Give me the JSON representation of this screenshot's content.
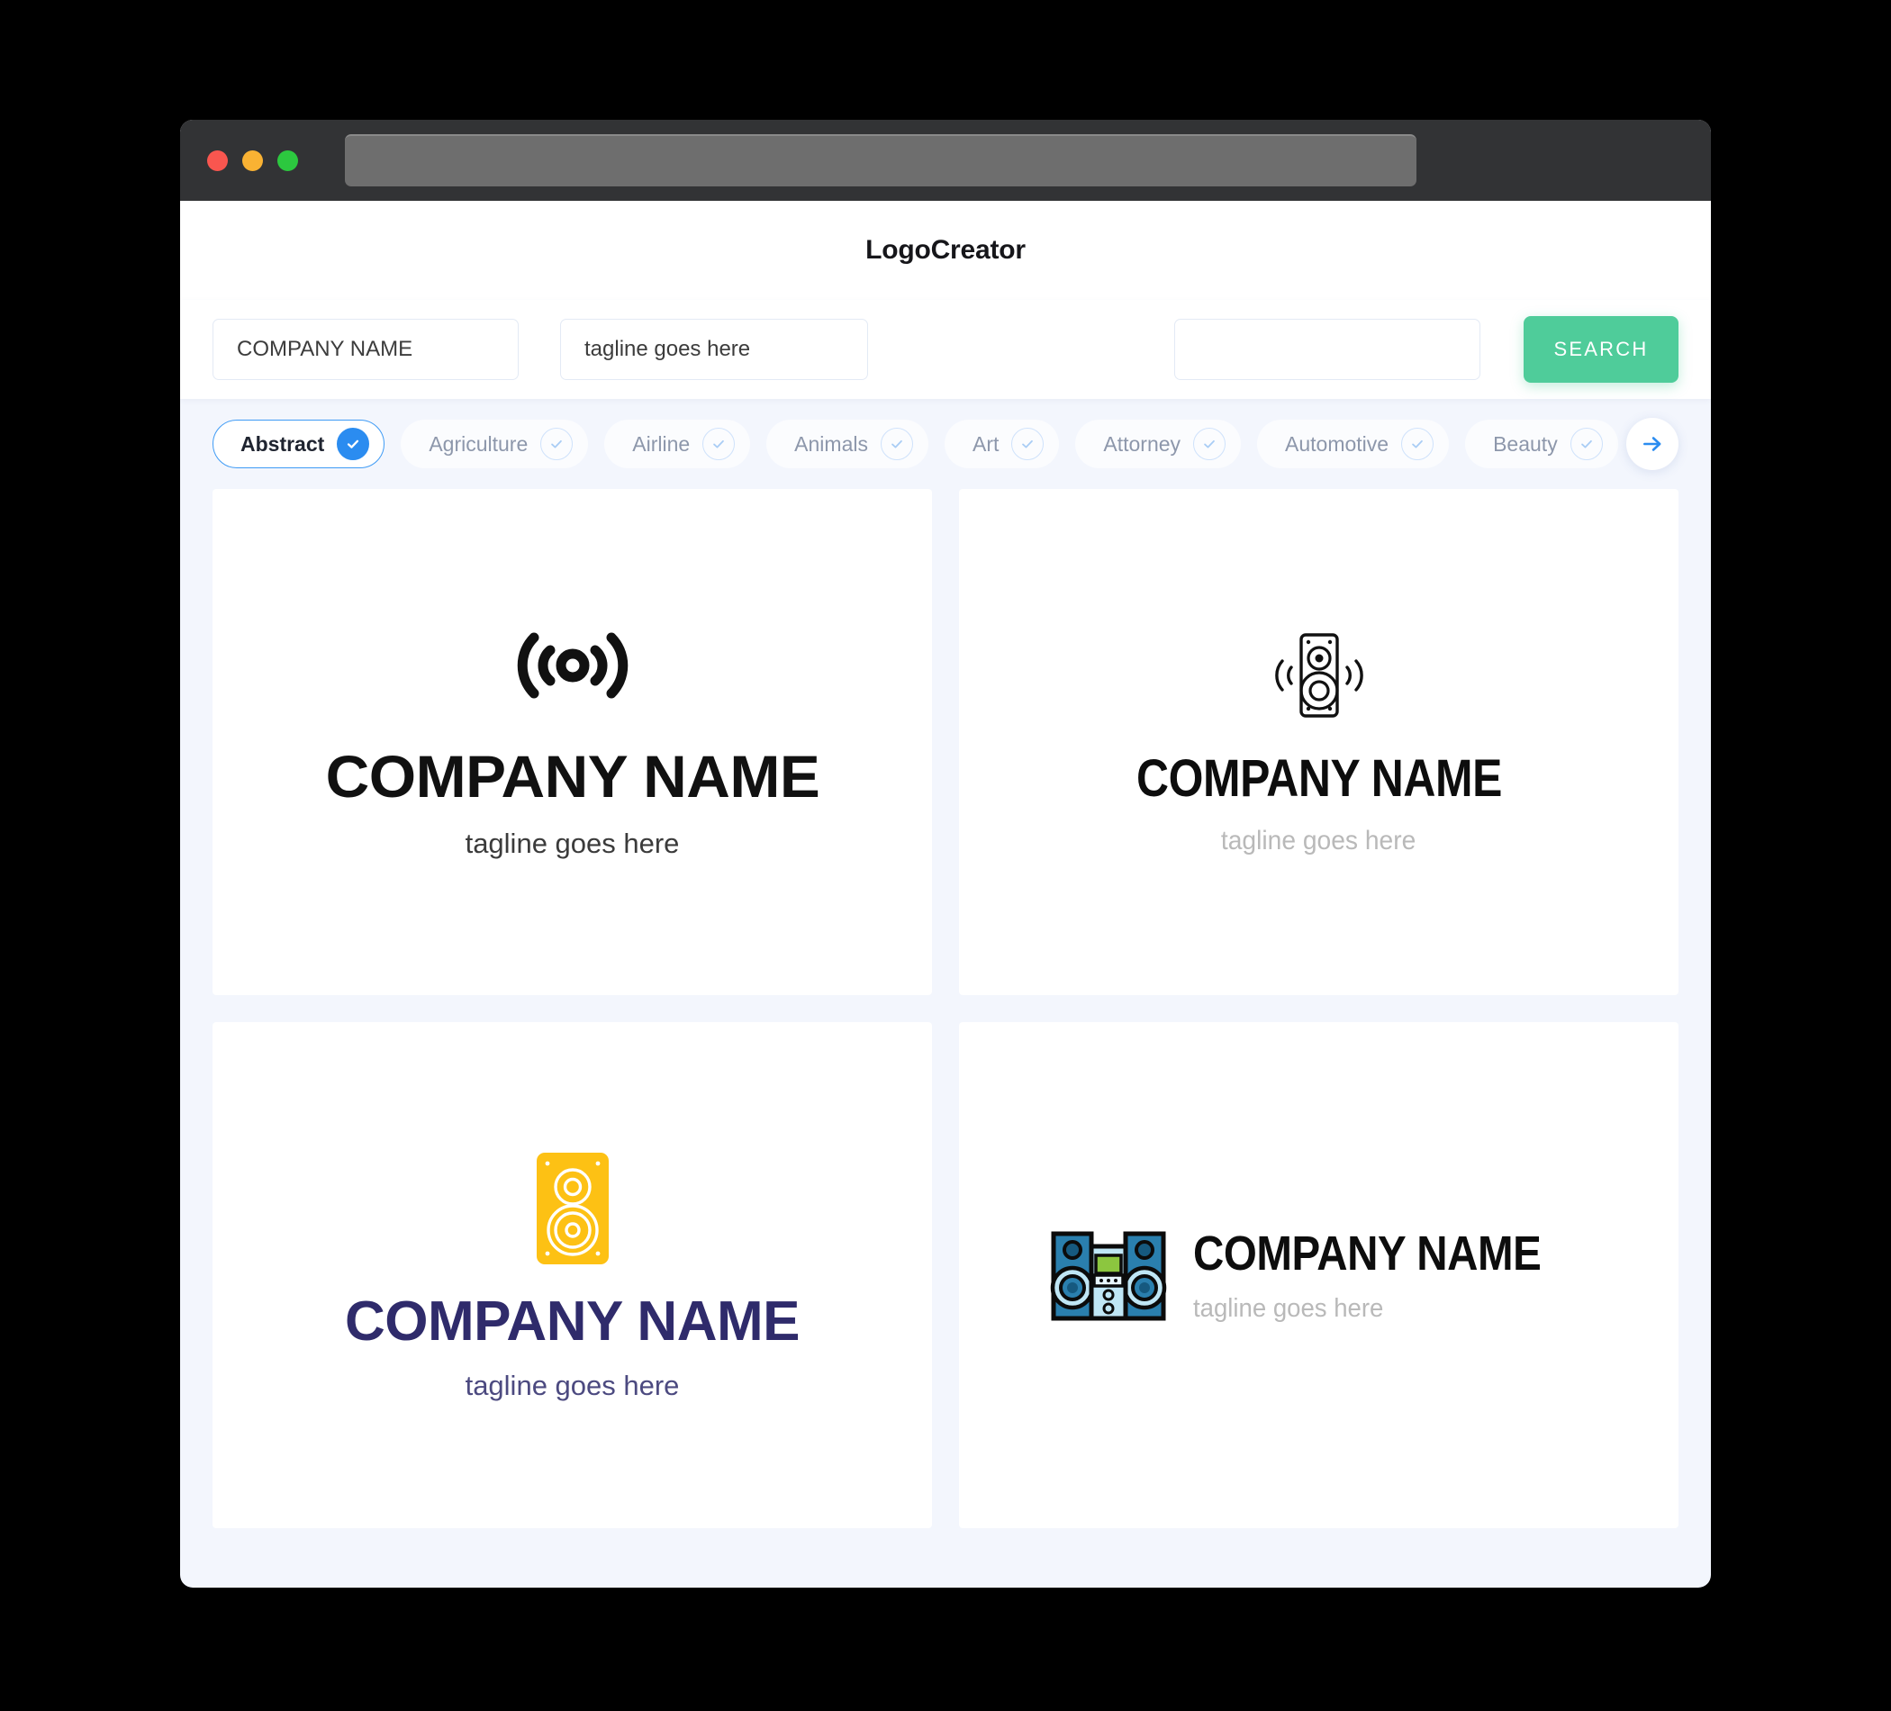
{
  "window": {
    "titlebar": {
      "traffic_lights": [
        "close",
        "minimize",
        "maximize"
      ],
      "url_value": ""
    }
  },
  "header": {
    "title": "LogoCreator"
  },
  "search": {
    "company_value": "COMPANY NAME",
    "company_placeholder": "COMPANY NAME",
    "tagline_value": "tagline goes here",
    "tagline_placeholder": "tagline goes here",
    "extra_value": "",
    "extra_placeholder": "",
    "button_label": "SEARCH",
    "button_color": "#4fcc9a"
  },
  "categories": {
    "selected": "Abstract",
    "accent": "#2b8cf0",
    "items": [
      {
        "label": "Abstract",
        "selected": true
      },
      {
        "label": "Agriculture",
        "selected": false
      },
      {
        "label": "Airline",
        "selected": false
      },
      {
        "label": "Animals",
        "selected": false
      },
      {
        "label": "Art",
        "selected": false
      },
      {
        "label": "Attorney",
        "selected": false
      },
      {
        "label": "Automotive",
        "selected": false
      },
      {
        "label": "Beauty",
        "selected": false
      }
    ],
    "next_label": "next"
  },
  "results": [
    {
      "id": "card-1",
      "icon": "signal-waves-icon",
      "name": "COMPANY NAME",
      "tagline": "tagline goes here",
      "name_color": "#111111",
      "tagline_color": "#3b3b3b",
      "layout": "stacked"
    },
    {
      "id": "card-2",
      "icon": "loudspeaker-waves-icon",
      "name": "COMPANY NAME",
      "tagline": "tagline goes here",
      "name_color": "#0d0d0d",
      "tagline_color": "#b9b9b9",
      "layout": "stacked"
    },
    {
      "id": "card-3",
      "icon": "speaker-box-icon",
      "name": "COMPANY NAME",
      "tagline": "tagline goes here",
      "name_color": "#2f2b6b",
      "tagline_color": "#4c4a80",
      "icon_color": "#fdc114",
      "layout": "stacked"
    },
    {
      "id": "card-4",
      "icon": "stereo-system-icon",
      "name": "COMPANY NAME",
      "tagline": "tagline goes here",
      "name_color": "#0d0d0d",
      "tagline_color": "#b9b9b9",
      "icon_colors": [
        "#2a7fae",
        "#1b5f8a",
        "#bfe6f5",
        "#8cc63f"
      ],
      "layout": "horizontal"
    }
  ]
}
